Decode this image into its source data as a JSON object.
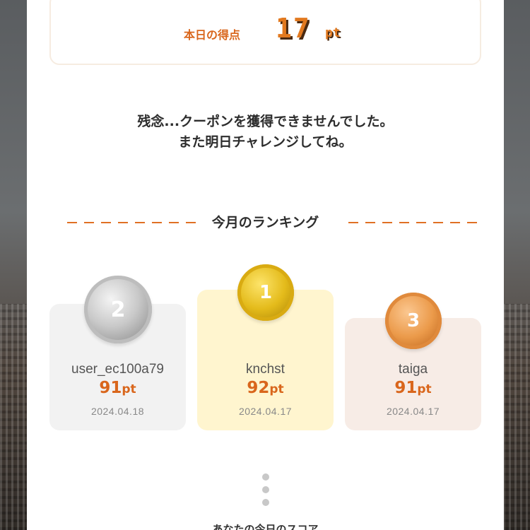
{
  "score": {
    "label": "本日の得点",
    "value": "17",
    "unit": "pt"
  },
  "message": {
    "line1": "残念...クーポンを獲得できませんでした。",
    "line2": "また明日チャレンジしてね。"
  },
  "ranking": {
    "title": "今月のランキング",
    "entries": [
      {
        "rank": "2",
        "name": "user_ec100a79",
        "score": "91",
        "unit": "pt",
        "date": "2024.04.18"
      },
      {
        "rank": "1",
        "name": "knchst",
        "score": "92",
        "unit": "pt",
        "date": "2024.04.17"
      },
      {
        "rank": "3",
        "name": "taiga",
        "score": "91",
        "unit": "pt",
        "date": "2024.04.17"
      }
    ]
  },
  "bottom": {
    "label": "あなたの今日のスコア"
  },
  "colors": {
    "accent": "#d9661c",
    "gold": "#e4bb1b",
    "silver": "#c9c9c9",
    "bronze": "#eb9a4a"
  }
}
